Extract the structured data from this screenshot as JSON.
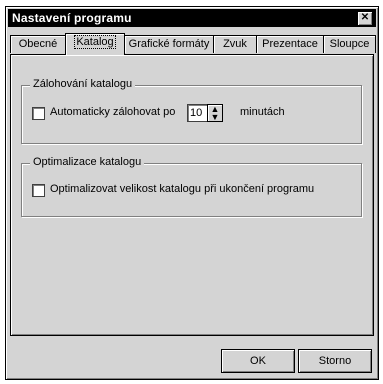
{
  "window": {
    "title": "Nastavení programu",
    "close_label": "✕"
  },
  "tabs": [
    {
      "label": "Obecné"
    },
    {
      "label": "Katalog"
    },
    {
      "label": "Grafické formáty"
    },
    {
      "label": "Zvuk"
    },
    {
      "label": "Prezentace"
    },
    {
      "label": "Sloupce"
    }
  ],
  "active_tab": "Katalog",
  "backup_group": {
    "title": "Zálohování katalogu",
    "checkbox_label": "Automaticky zálohovat po",
    "checked": false,
    "interval_value": "10",
    "unit_label": "minutách"
  },
  "optimize_group": {
    "title": "Optimalizace katalogu",
    "checkbox_label": "Optimalizovat velikost katalogu při ukončení programu",
    "checked": false
  },
  "buttons": {
    "ok": "OK",
    "cancel": "Storno"
  }
}
